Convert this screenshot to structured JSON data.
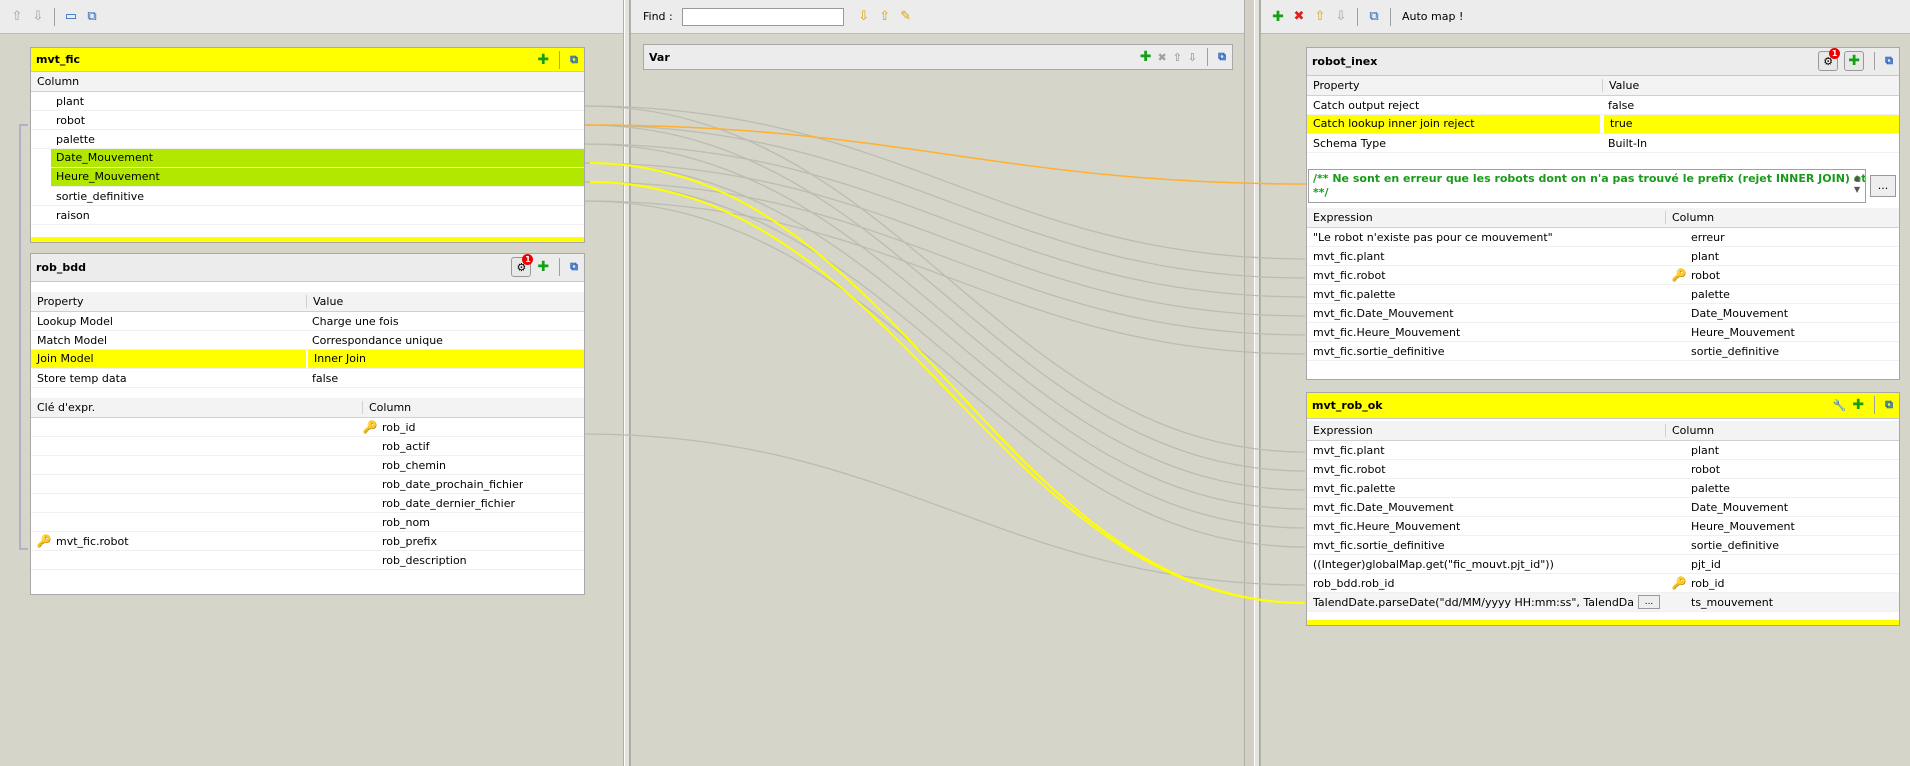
{
  "toolbar_mid": {
    "find_label": "Find :",
    "find_value": ""
  },
  "toolbar_right": {
    "automap_label": "Auto map !"
  },
  "var_table": {
    "title": "Var"
  },
  "mvt_fic": {
    "title": "mvt_fic",
    "column_header": "Column",
    "columns": [
      "plant",
      "robot",
      "palette",
      "Date_Mouvement",
      "Heure_Mouvement",
      "sortie_definitive",
      "raison"
    ]
  },
  "rob_bdd": {
    "title": "rob_bdd",
    "badge": "1",
    "prop_header": "Property",
    "value_header": "Value",
    "props": [
      {
        "p": "Lookup Model",
        "v": "Charge une fois"
      },
      {
        "p": "Match Model",
        "v": "Correspondance unique"
      },
      {
        "p": "Join Model",
        "v": "Inner Join"
      },
      {
        "p": "Store temp data",
        "v": "false"
      }
    ],
    "key_header": "Clé d'expr.",
    "col_header": "Column",
    "rows": [
      {
        "k": "",
        "c": "rob_id"
      },
      {
        "k": "",
        "c": "rob_actif"
      },
      {
        "k": "",
        "c": "rob_chemin"
      },
      {
        "k": "",
        "c": "rob_date_prochain_fichier"
      },
      {
        "k": "",
        "c": "rob_date_dernier_fichier"
      },
      {
        "k": "",
        "c": "rob_nom"
      },
      {
        "k": "mvt_fic.robot",
        "c": "rob_prefix"
      },
      {
        "k": "",
        "c": "rob_description"
      }
    ]
  },
  "robot_inex": {
    "title": "robot_inex",
    "badge": "1",
    "prop_header": "Property",
    "value_header": "Value",
    "props": [
      {
        "p": "Catch output reject",
        "v": "false"
      },
      {
        "p": "Catch lookup inner join reject",
        "v": "true"
      },
      {
        "p": "Schema Type",
        "v": "Built-In"
      }
    ],
    "filter_line1": "/** Ne sont en erreur que les robots dont on n'a pas trouvé le prefix (rejet INNER JOIN) et pour le",
    "filter_line2": "**/",
    "dots": "...",
    "expr_header": "Expression",
    "col_header": "Column",
    "rows": [
      {
        "e": "\"Le robot n'existe pas pour ce mouvement\"",
        "c": "erreur"
      },
      {
        "e": "mvt_fic.plant",
        "c": "plant"
      },
      {
        "e": "mvt_fic.robot",
        "c": "robot"
      },
      {
        "e": "mvt_fic.palette",
        "c": "palette"
      },
      {
        "e": "mvt_fic.Date_Mouvement",
        "c": "Date_Mouvement"
      },
      {
        "e": "mvt_fic.Heure_Mouvement",
        "c": "Heure_Mouvement"
      },
      {
        "e": "mvt_fic.sortie_definitive",
        "c": "sortie_definitive"
      }
    ]
  },
  "mvt_rob_ok": {
    "title": "mvt_rob_ok",
    "expr_header": "Expression",
    "col_header": "Column",
    "dots": "...",
    "rows": [
      {
        "e": "mvt_fic.plant",
        "c": "plant"
      },
      {
        "e": "mvt_fic.robot",
        "c": "robot"
      },
      {
        "e": "mvt_fic.palette",
        "c": "palette"
      },
      {
        "e": "mvt_fic.Date_Mouvement",
        "c": "Date_Mouvement"
      },
      {
        "e": "mvt_fic.Heure_Mouvement",
        "c": "Heure_Mouvement"
      },
      {
        "e": "mvt_fic.sortie_definitive",
        "c": "sortie_definitive"
      },
      {
        "e": "((Integer)globalMap.get(\"fic_mouvt.pjt_id\"))",
        "c": "pjt_id"
      },
      {
        "e": "rob_bdd.rob_id",
        "c": "rob_id"
      },
      {
        "e": "TalendDate.parseDate(\"dd/MM/yyyy HH:mm:ss\", TalendDate",
        "c": "ts_mouvement"
      }
    ]
  },
  "colors": {
    "highlight": "#ffff00",
    "selected": "#b2e800",
    "link_yellow": "#ffff00",
    "link_orange": "#ffb030",
    "link_gray": "#bcbcb0"
  }
}
